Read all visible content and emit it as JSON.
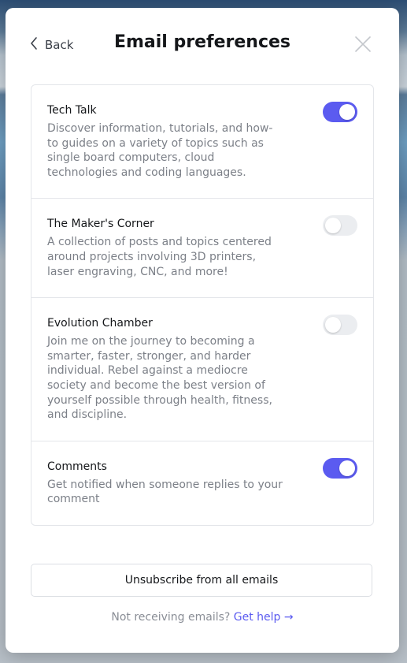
{
  "header": {
    "back_label": "Back",
    "title": "Email preferences"
  },
  "newsletters": [
    {
      "title": "Tech Talk",
      "description": "Discover information, tutorials, and how-to guides on a variety of topics such as single board computers, cloud technologies and coding languages.",
      "enabled": true
    },
    {
      "title": "The Maker's Corner",
      "description": "A collection of posts and topics centered around projects involving 3D printers, laser engraving, CNC, and more!",
      "enabled": false
    },
    {
      "title": "Evolution Chamber",
      "description": "Join me on the journey to becoming a smarter, faster, stronger, and harder individual. Rebel against a mediocre society and become the best version of yourself possible through health, fitness, and discipline.",
      "enabled": false
    },
    {
      "title": "Comments",
      "description": "Get notified when someone replies to your comment",
      "enabled": true
    }
  ],
  "footer": {
    "unsubscribe_label": "Unsubscribe from all emails",
    "help_text": "Not receiving emails?",
    "help_link": "Get help →"
  },
  "colors": {
    "accent": "#5b5bf0",
    "toggle_off": "#ebedf0"
  }
}
